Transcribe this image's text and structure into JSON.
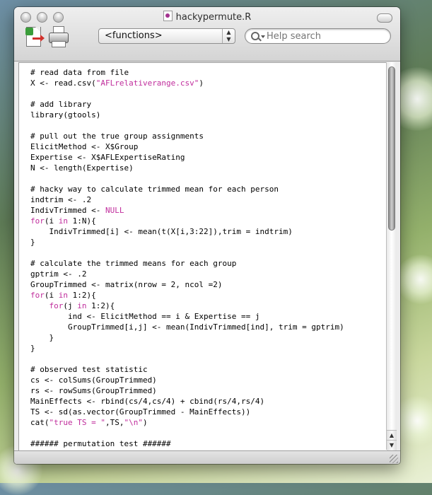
{
  "window": {
    "title": "hackypermute.R"
  },
  "toolbar": {
    "new_doc_icon": "new-document-icon",
    "print_icon": "printer-icon",
    "functions_popup": "<functions>",
    "search_placeholder": "Help search"
  },
  "editor": {
    "lines": [
      [
        {
          "t": "# read data from file",
          "c": ""
        }
      ],
      [
        {
          "t": "X <- read.csv(",
          "c": ""
        },
        {
          "t": "\"AFLrelativerange.csv\"",
          "c": "st"
        },
        {
          "t": ")",
          "c": ""
        }
      ],
      [
        {
          "t": "",
          "c": ""
        }
      ],
      [
        {
          "t": "# add library",
          "c": ""
        }
      ],
      [
        {
          "t": "library(gtools)",
          "c": ""
        }
      ],
      [
        {
          "t": "",
          "c": ""
        }
      ],
      [
        {
          "t": "# pull out the true group assignments",
          "c": ""
        }
      ],
      [
        {
          "t": "ElicitMethod <- X$Group",
          "c": ""
        }
      ],
      [
        {
          "t": "Expertise <- X$AFLExpertiseRating",
          "c": ""
        }
      ],
      [
        {
          "t": "N <- length(Expertise)",
          "c": ""
        }
      ],
      [
        {
          "t": "",
          "c": ""
        }
      ],
      [
        {
          "t": "# hacky way to calculate trimmed mean for each person",
          "c": ""
        }
      ],
      [
        {
          "t": "indtrim <- .2",
          "c": ""
        }
      ],
      [
        {
          "t": "IndivTrimmed <- ",
          "c": ""
        },
        {
          "t": "NULL",
          "c": "kw"
        }
      ],
      [
        {
          "t": "for",
          "c": "kw"
        },
        {
          "t": "(i ",
          "c": ""
        },
        {
          "t": "in",
          "c": "kw"
        },
        {
          "t": " 1:N){",
          "c": ""
        }
      ],
      [
        {
          "t": "    IndivTrimmed[i] <- mean(t(X[i,3:22]),trim = indtrim)",
          "c": ""
        }
      ],
      [
        {
          "t": "}",
          "c": ""
        }
      ],
      [
        {
          "t": "",
          "c": ""
        }
      ],
      [
        {
          "t": "# calculate the trimmed means for each group",
          "c": ""
        }
      ],
      [
        {
          "t": "gptrim <- .2",
          "c": ""
        }
      ],
      [
        {
          "t": "GroupTrimmed <- matrix(nrow = 2, ncol =2)",
          "c": ""
        }
      ],
      [
        {
          "t": "for",
          "c": "kw"
        },
        {
          "t": "(i ",
          "c": ""
        },
        {
          "t": "in",
          "c": "kw"
        },
        {
          "t": " 1:2){",
          "c": ""
        }
      ],
      [
        {
          "t": "    ",
          "c": ""
        },
        {
          "t": "for",
          "c": "kw"
        },
        {
          "t": "(j ",
          "c": ""
        },
        {
          "t": "in",
          "c": "kw"
        },
        {
          "t": " 1:2){",
          "c": ""
        }
      ],
      [
        {
          "t": "        ind <- ElicitMethod == i & Expertise == j",
          "c": ""
        }
      ],
      [
        {
          "t": "        GroupTrimmed[i,j] <- mean(IndivTrimmed[ind], trim = gptrim)",
          "c": ""
        }
      ],
      [
        {
          "t": "    }",
          "c": ""
        }
      ],
      [
        {
          "t": "}",
          "c": ""
        }
      ],
      [
        {
          "t": "",
          "c": ""
        }
      ],
      [
        {
          "t": "# observed test statistic",
          "c": ""
        }
      ],
      [
        {
          "t": "cs <- colSums(GroupTrimmed)",
          "c": ""
        }
      ],
      [
        {
          "t": "rs <- rowSums(GroupTrimmed)",
          "c": ""
        }
      ],
      [
        {
          "t": "MainEffects <- rbind(cs/4,cs/4) + cbind(rs/4,rs/4)",
          "c": ""
        }
      ],
      [
        {
          "t": "TS <- sd(as.vector(GroupTrimmed - MainEffects))",
          "c": ""
        }
      ],
      [
        {
          "t": "cat(",
          "c": ""
        },
        {
          "t": "\"true TS = \"",
          "c": "st"
        },
        {
          "t": ",TS,",
          "c": ""
        },
        {
          "t": "\"\\n\"",
          "c": "st"
        },
        {
          "t": ")",
          "c": ""
        }
      ],
      [
        {
          "t": "",
          "c": ""
        }
      ],
      [
        {
          "t": "###### permutation test ######",
          "c": ""
        }
      ]
    ]
  },
  "colors": {
    "keyword": "#c02d9c",
    "text": "#000000"
  }
}
